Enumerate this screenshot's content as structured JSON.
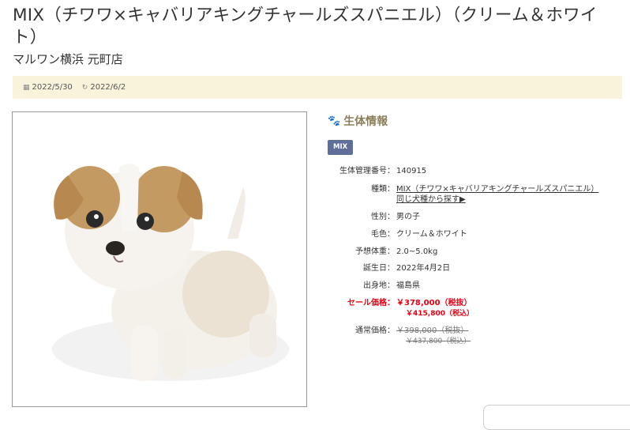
{
  "page": {
    "title": "MIX（チワワ×キャバリアキングチャールズスパニエル）（クリーム＆ホワイト）",
    "shop": "マルワン横浜 元町店"
  },
  "dates": {
    "posted": "2022/5/30",
    "updated": "2022/6/2"
  },
  "info": {
    "heading": "生体情報",
    "badge": "MIX",
    "rows": {
      "id": {
        "label": "生体管理番号：",
        "value": "140915"
      },
      "breed": {
        "label": "種類：",
        "value": "MIX（チワワ×キャバリアキングチャールズスパニエル）",
        "link2": "同じ犬種から探す▶"
      },
      "sex": {
        "label": "性別：",
        "value": "男の子"
      },
      "color": {
        "label": "毛色：",
        "value": "クリーム＆ホワイト"
      },
      "weight": {
        "label": "予想体重：",
        "value": "2.0~5.0kg"
      },
      "birthday": {
        "label": "誕生日：",
        "value": "2022年4月2日"
      },
      "origin": {
        "label": "出身地：",
        "value": "福島県"
      },
      "sale": {
        "label": "セール価格：",
        "value": "￥378,000（税抜）",
        "sub": "￥415,800（税込）"
      },
      "regular": {
        "label": "通常価格：",
        "value": "￥398,000（税抜）",
        "sub": "￥437,800（税込）"
      }
    }
  },
  "colors": {
    "datebar_bg": "#f8f3da",
    "badge_bg": "#5f6f9a",
    "sale_red": "#e60012",
    "heading": "#8a7f5a"
  },
  "icons": {
    "posted": "calendar-icon",
    "updated": "refresh-icon",
    "heading": "paw-icon"
  }
}
